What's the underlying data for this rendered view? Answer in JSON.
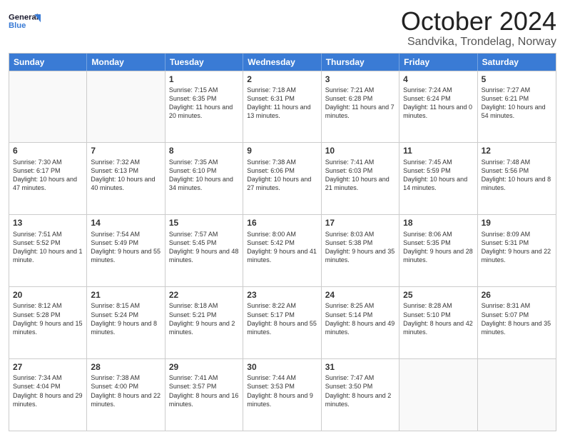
{
  "header": {
    "logo_line1": "General",
    "logo_line2": "Blue",
    "title": "October 2024",
    "location": "Sandvika, Trondelag, Norway"
  },
  "days_of_week": [
    "Sunday",
    "Monday",
    "Tuesday",
    "Wednesday",
    "Thursday",
    "Friday",
    "Saturday"
  ],
  "weeks": [
    [
      {
        "day": "",
        "sunrise": "",
        "sunset": "",
        "daylight": "",
        "empty": true
      },
      {
        "day": "",
        "sunrise": "",
        "sunset": "",
        "daylight": "",
        "empty": true
      },
      {
        "day": "1",
        "sunrise": "Sunrise: 7:15 AM",
        "sunset": "Sunset: 6:35 PM",
        "daylight": "Daylight: 11 hours and 20 minutes."
      },
      {
        "day": "2",
        "sunrise": "Sunrise: 7:18 AM",
        "sunset": "Sunset: 6:31 PM",
        "daylight": "Daylight: 11 hours and 13 minutes."
      },
      {
        "day": "3",
        "sunrise": "Sunrise: 7:21 AM",
        "sunset": "Sunset: 6:28 PM",
        "daylight": "Daylight: 11 hours and 7 minutes."
      },
      {
        "day": "4",
        "sunrise": "Sunrise: 7:24 AM",
        "sunset": "Sunset: 6:24 PM",
        "daylight": "Daylight: 11 hours and 0 minutes."
      },
      {
        "day": "5",
        "sunrise": "Sunrise: 7:27 AM",
        "sunset": "Sunset: 6:21 PM",
        "daylight": "Daylight: 10 hours and 54 minutes."
      }
    ],
    [
      {
        "day": "6",
        "sunrise": "Sunrise: 7:30 AM",
        "sunset": "Sunset: 6:17 PM",
        "daylight": "Daylight: 10 hours and 47 minutes."
      },
      {
        "day": "7",
        "sunrise": "Sunrise: 7:32 AM",
        "sunset": "Sunset: 6:13 PM",
        "daylight": "Daylight: 10 hours and 40 minutes."
      },
      {
        "day": "8",
        "sunrise": "Sunrise: 7:35 AM",
        "sunset": "Sunset: 6:10 PM",
        "daylight": "Daylight: 10 hours and 34 minutes."
      },
      {
        "day": "9",
        "sunrise": "Sunrise: 7:38 AM",
        "sunset": "Sunset: 6:06 PM",
        "daylight": "Daylight: 10 hours and 27 minutes."
      },
      {
        "day": "10",
        "sunrise": "Sunrise: 7:41 AM",
        "sunset": "Sunset: 6:03 PM",
        "daylight": "Daylight: 10 hours and 21 minutes."
      },
      {
        "day": "11",
        "sunrise": "Sunrise: 7:45 AM",
        "sunset": "Sunset: 5:59 PM",
        "daylight": "Daylight: 10 hours and 14 minutes."
      },
      {
        "day": "12",
        "sunrise": "Sunrise: 7:48 AM",
        "sunset": "Sunset: 5:56 PM",
        "daylight": "Daylight: 10 hours and 8 minutes."
      }
    ],
    [
      {
        "day": "13",
        "sunrise": "Sunrise: 7:51 AM",
        "sunset": "Sunset: 5:52 PM",
        "daylight": "Daylight: 10 hours and 1 minute."
      },
      {
        "day": "14",
        "sunrise": "Sunrise: 7:54 AM",
        "sunset": "Sunset: 5:49 PM",
        "daylight": "Daylight: 9 hours and 55 minutes."
      },
      {
        "day": "15",
        "sunrise": "Sunrise: 7:57 AM",
        "sunset": "Sunset: 5:45 PM",
        "daylight": "Daylight: 9 hours and 48 minutes."
      },
      {
        "day": "16",
        "sunrise": "Sunrise: 8:00 AM",
        "sunset": "Sunset: 5:42 PM",
        "daylight": "Daylight: 9 hours and 41 minutes."
      },
      {
        "day": "17",
        "sunrise": "Sunrise: 8:03 AM",
        "sunset": "Sunset: 5:38 PM",
        "daylight": "Daylight: 9 hours and 35 minutes."
      },
      {
        "day": "18",
        "sunrise": "Sunrise: 8:06 AM",
        "sunset": "Sunset: 5:35 PM",
        "daylight": "Daylight: 9 hours and 28 minutes."
      },
      {
        "day": "19",
        "sunrise": "Sunrise: 8:09 AM",
        "sunset": "Sunset: 5:31 PM",
        "daylight": "Daylight: 9 hours and 22 minutes."
      }
    ],
    [
      {
        "day": "20",
        "sunrise": "Sunrise: 8:12 AM",
        "sunset": "Sunset: 5:28 PM",
        "daylight": "Daylight: 9 hours and 15 minutes."
      },
      {
        "day": "21",
        "sunrise": "Sunrise: 8:15 AM",
        "sunset": "Sunset: 5:24 PM",
        "daylight": "Daylight: 9 hours and 8 minutes."
      },
      {
        "day": "22",
        "sunrise": "Sunrise: 8:18 AM",
        "sunset": "Sunset: 5:21 PM",
        "daylight": "Daylight: 9 hours and 2 minutes."
      },
      {
        "day": "23",
        "sunrise": "Sunrise: 8:22 AM",
        "sunset": "Sunset: 5:17 PM",
        "daylight": "Daylight: 8 hours and 55 minutes."
      },
      {
        "day": "24",
        "sunrise": "Sunrise: 8:25 AM",
        "sunset": "Sunset: 5:14 PM",
        "daylight": "Daylight: 8 hours and 49 minutes."
      },
      {
        "day": "25",
        "sunrise": "Sunrise: 8:28 AM",
        "sunset": "Sunset: 5:10 PM",
        "daylight": "Daylight: 8 hours and 42 minutes."
      },
      {
        "day": "26",
        "sunrise": "Sunrise: 8:31 AM",
        "sunset": "Sunset: 5:07 PM",
        "daylight": "Daylight: 8 hours and 35 minutes."
      }
    ],
    [
      {
        "day": "27",
        "sunrise": "Sunrise: 7:34 AM",
        "sunset": "Sunset: 4:04 PM",
        "daylight": "Daylight: 8 hours and 29 minutes."
      },
      {
        "day": "28",
        "sunrise": "Sunrise: 7:38 AM",
        "sunset": "Sunset: 4:00 PM",
        "daylight": "Daylight: 8 hours and 22 minutes."
      },
      {
        "day": "29",
        "sunrise": "Sunrise: 7:41 AM",
        "sunset": "Sunset: 3:57 PM",
        "daylight": "Daylight: 8 hours and 16 minutes."
      },
      {
        "day": "30",
        "sunrise": "Sunrise: 7:44 AM",
        "sunset": "Sunset: 3:53 PM",
        "daylight": "Daylight: 8 hours and 9 minutes."
      },
      {
        "day": "31",
        "sunrise": "Sunrise: 7:47 AM",
        "sunset": "Sunset: 3:50 PM",
        "daylight": "Daylight: 8 hours and 2 minutes."
      },
      {
        "day": "",
        "sunrise": "",
        "sunset": "",
        "daylight": "",
        "empty": true
      },
      {
        "day": "",
        "sunrise": "",
        "sunset": "",
        "daylight": "",
        "empty": true
      }
    ]
  ]
}
